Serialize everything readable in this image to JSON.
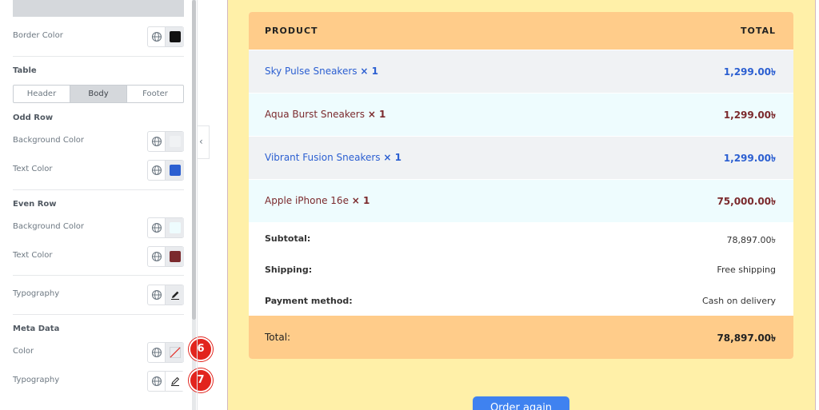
{
  "panel": {
    "border_color_label": "Border Color",
    "table_title": "Table",
    "tabs": [
      {
        "label": "Header",
        "active": false
      },
      {
        "label": "Body",
        "active": true
      },
      {
        "label": "Footer",
        "active": false
      }
    ],
    "odd_row": {
      "title": "Odd Row",
      "bg_label": "Background Color",
      "text_label": "Text Color"
    },
    "even_row": {
      "title": "Even Row",
      "bg_label": "Background Color",
      "text_label": "Text Color"
    },
    "typography_label": "Typography",
    "meta": {
      "title": "Meta Data",
      "color_label": "Color",
      "typography_label": "Typography"
    },
    "badges": [
      "6",
      "7"
    ],
    "collapse_glyph": "‹"
  },
  "colors": {
    "border_swatch": "#111111",
    "odd_bg_swatch": "#f0f2f4",
    "odd_text_swatch": "#2b5fd1",
    "even_bg_swatch": "#eefcfe",
    "even_text_swatch": "#7b2a2d",
    "accent_header": "#ffcc8a",
    "canvas_bg": "#fff0a8",
    "button_blue": "#3f82f0"
  },
  "order": {
    "headers": {
      "product": "PRODUCT",
      "total": "TOTAL"
    },
    "items": [
      {
        "name": "Sky Pulse Sneakers",
        "qty": "× 1",
        "total": "1,299.00৳"
      },
      {
        "name": "Aqua Burst Sneakers",
        "qty": "× 1",
        "total": "1,299.00৳"
      },
      {
        "name": "Vibrant Fusion Sneakers",
        "qty": "× 1",
        "total": "1,299.00৳"
      },
      {
        "name": "Apple iPhone 16e",
        "qty": "× 1",
        "total": "75,000.00৳"
      }
    ],
    "summary": [
      {
        "label": "Subtotal:",
        "value": "78,897.00৳"
      },
      {
        "label": "Shipping:",
        "value": "Free shipping"
      },
      {
        "label": "Payment method:",
        "value": "Cash on delivery"
      }
    ],
    "total": {
      "label": "Total:",
      "value": "78,897.00৳"
    },
    "button_label": "Order again"
  }
}
